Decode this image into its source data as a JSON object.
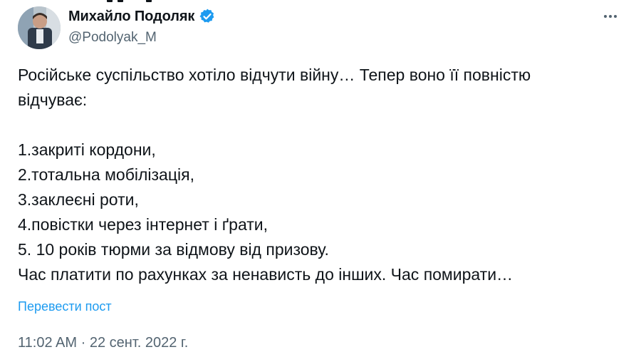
{
  "author": {
    "display_name": "Михайло Подоляк",
    "handle": "@Podolyak_M",
    "verified": true,
    "avatar_icon": "person-avatar-icon",
    "badge_color": "#1d9bf0"
  },
  "menu": {
    "more_icon": "more-horizontal-icon"
  },
  "tweet": {
    "lines": [
      "Російське суспільство хотіло відчути війну… Тепер воно її повністю",
      "відчуває:",
      "",
      "1.закриті кордони,",
      "2.тотальна мобілізація,",
      "3.заклеєні роти,",
      "4.повістки через інтернет і ґрати,",
      "5. 10 років тюрми за відмову від призову.",
      "Час платити по рахунках за ненависть до інших. Час помирати…"
    ],
    "translate_label": "Перевести пост"
  },
  "meta": {
    "time": "11:02 AM",
    "separator": "·",
    "date": "22 сент. 2022 г."
  },
  "colors": {
    "text": "#0f1419",
    "secondary": "#536471",
    "link": "#1d9bf0"
  }
}
